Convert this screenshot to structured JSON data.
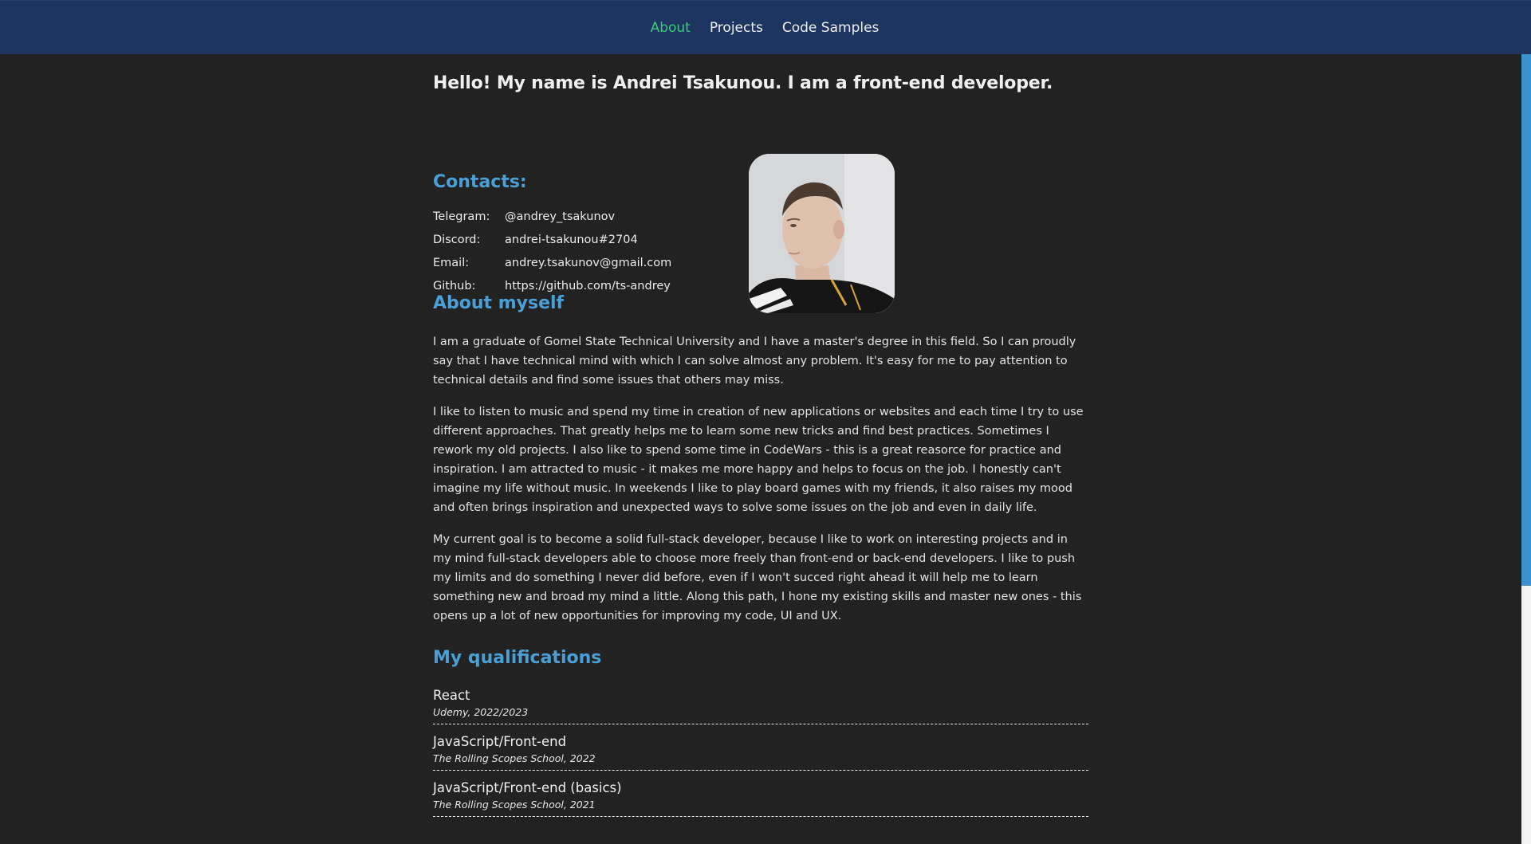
{
  "nav": {
    "items": [
      {
        "label": "About",
        "active": true
      },
      {
        "label": "Projects",
        "active": false
      },
      {
        "label": "Code Samples",
        "active": false
      }
    ],
    "active_color": "#3ec97a",
    "bar_color": "#1e3461"
  },
  "intro": "Hello! My name is Andrei Tsakunou. I am a front-end developer.",
  "contacts": {
    "title": "Contacts:",
    "rows": [
      {
        "key": "Telegram:",
        "value": "@andrey_tsakunov"
      },
      {
        "key": "Discord:",
        "value": "andrei-tsakunou#2704"
      },
      {
        "key": "Email:",
        "value": "andrey.tsakunov@gmail.com"
      },
      {
        "key": "Github:",
        "value": "https://github.com/ts-andrey"
      }
    ]
  },
  "about": {
    "title": "About myself",
    "paragraphs": [
      "I am a graduate of Gomel State Technical University and I have a master's degree in this field. So I can proudly say that I have technical mind with which I can solve almost any problem. It's easy for me to pay attention to technical details and find some issues that others may miss.",
      "I like to listen to music and spend my time in creation of new applications or websites and each time I try to use different approaches. That greatly helps me to learn some new tricks and find best practices. Sometimes I rework my old projects. I also like to spend some time in CodeWars - this is a great reasorce for practice and inspiration. I am attracted to music - it makes me more happy and helps to focus on the job. I honestly can't imagine my life without music. In weekends I like to play board games with my friends, it also raises my mood and often brings inspiration and unexpected ways to solve some issues on the job and even in daily life.",
      "My current goal is to become a solid full-stack developer, because I like to work on interesting projects and in my mind full-stack developers able to choose more freely than front-end or back-end developers. I like to push my limits and do something I never did before, even if I won't succed right ahead it will help me to learn something new and broad my mind a little. Along this path, I hone my existing skills and master new ones - this opens up a lot of new opportunities for improving my code, UI and UX."
    ]
  },
  "qualifications": {
    "title": "My qualifications",
    "items": [
      {
        "name": "React",
        "meta": "Udemy, 2022/2023"
      },
      {
        "name": "JavaScript/Front-end",
        "meta": "The Rolling Scopes School, 2022"
      },
      {
        "name": "JavaScript/Front-end (basics)",
        "meta": "The Rolling Scopes School, 2021"
      }
    ]
  }
}
